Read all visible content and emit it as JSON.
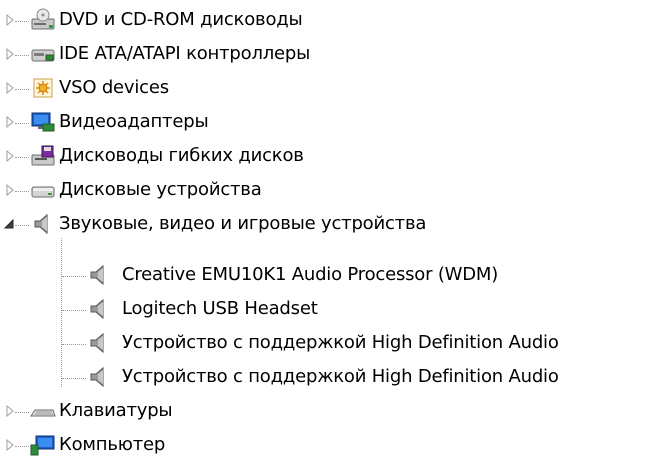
{
  "tree": {
    "items": [
      {
        "label": "DVD и CD-ROM дисководы",
        "icon": "dvd-drive-icon",
        "state": "collapsed"
      },
      {
        "label": "IDE ATA/ATAPI контроллеры",
        "icon": "ide-controller-icon",
        "state": "collapsed"
      },
      {
        "label": "VSO devices",
        "icon": "vso-device-icon",
        "state": "collapsed"
      },
      {
        "label": "Видеоадаптеры",
        "icon": "display-adapter-icon",
        "state": "collapsed"
      },
      {
        "label": "Дисководы гибких дисков",
        "icon": "floppy-drive-icon",
        "state": "collapsed"
      },
      {
        "label": "Дисковые устройства",
        "icon": "disk-drive-icon",
        "state": "collapsed"
      },
      {
        "label": "Звуковые, видео и игровые устройства",
        "icon": "speaker-icon",
        "state": "expanded",
        "children": [
          {
            "label": "Creative EMU10K1 Audio Processor (WDM)",
            "icon": "speaker-icon"
          },
          {
            "label": "Logitech USB Headset",
            "icon": "speaker-icon"
          },
          {
            "label": "Устройство с поддержкой High Definition Audio",
            "icon": "speaker-icon"
          },
          {
            "label": "Устройство с поддержкой High Definition Audio",
            "icon": "speaker-icon"
          }
        ]
      },
      {
        "label": "Клавиатуры",
        "icon": "keyboard-icon",
        "state": "collapsed"
      },
      {
        "label": "Компьютер",
        "icon": "computer-icon",
        "state": "collapsed"
      }
    ]
  }
}
